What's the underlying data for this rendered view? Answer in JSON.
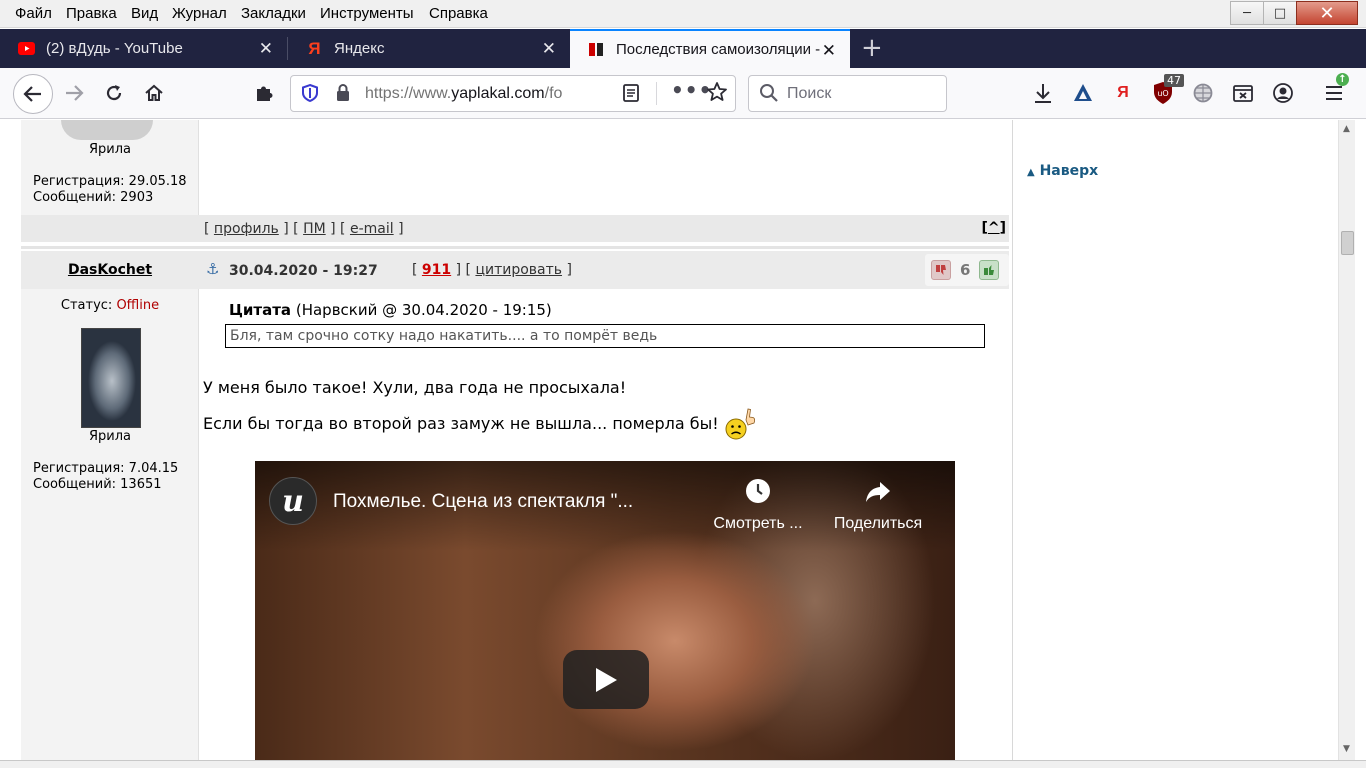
{
  "menubar": {
    "items": [
      "Файл",
      "Правка",
      "Вид",
      "Журнал",
      "Закладки",
      "Инструменты",
      "Справка"
    ]
  },
  "tabs": [
    {
      "title": "(2) вДудь - YouTube",
      "active": false
    },
    {
      "title": "Яндекс",
      "active": false
    },
    {
      "title": "Последствия самоизоляции -",
      "active": true
    }
  ],
  "navbar": {
    "url_scheme": "https://www.",
    "url_domain": "yaplakal.com",
    "url_path": "/fo",
    "search_placeholder": "Поиск",
    "ublock_badge": "47"
  },
  "post_prev": {
    "username": "Ярила",
    "reg_label": "Регистрация: 29.05.18",
    "msgs_label": "Сообщений: 2903",
    "links": {
      "profile": "профиль",
      "pm": "ПМ",
      "email": "e-mail"
    },
    "top_link": "^"
  },
  "post": {
    "author": "DasKochet",
    "status_label": "Статус:",
    "status_value": "Offline",
    "username": "Ярила",
    "reg_label": "Регистрация: 7.04.15",
    "msgs_label": "Сообщений: 13651",
    "datetime": "30.04.2020 - 19:27",
    "post_number": "911",
    "quote_link": "цитировать",
    "rating": "6",
    "quote_title": "Цитата",
    "quote_meta": "(Нарвский @ 30.04.2020 - 19:15)",
    "quote_text": "Бля, там срочно сотку надо накатить.... а то помрёт ведь",
    "body_line1": "У меня было такое! Хули, два года не просыхала!",
    "body_line2": "Если бы тогда во второй раз замуж не вышла... померла бы!"
  },
  "video": {
    "title": "Похмелье. Сцена из спектакля \"...",
    "watch_later": "Смотреть ...",
    "share": "Поделиться"
  },
  "sidebar": {
    "to_top": "Наверх"
  },
  "colors": {
    "tabbar_bg": "#202340",
    "offline": "#b00000",
    "post_number": "#cc0000",
    "to_top": "#1a5a82"
  }
}
